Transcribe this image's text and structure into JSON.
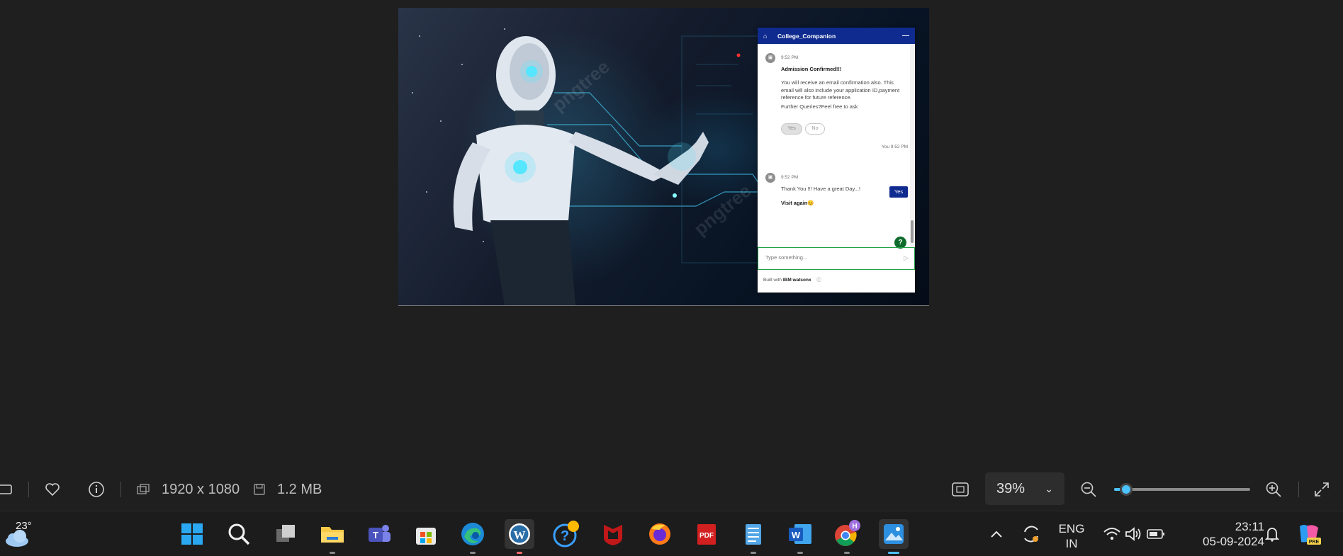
{
  "chat": {
    "title": "College_Companion",
    "messages": [
      {
        "time": "9:52 PM",
        "heading": "Admission Confirmed!!!",
        "body": "You will receive an email confirmation also. This email will also include your application ID,payment reference for future reference.",
        "followup": "Further Queries?Feel free to ask",
        "options": [
          "Yes",
          "No"
        ]
      },
      {
        "sender": "You 9:52 PM",
        "text": "Yes"
      },
      {
        "time": "9:52 PM",
        "text": "Thank You !!! Have a great Day...!",
        "closing": "Visit again😊"
      }
    ],
    "input_placeholder": "Type something...",
    "footer_prefix": "Built with",
    "footer_brand": "IBM watsonx",
    "help_label": "?"
  },
  "viewer": {
    "dimensions": "1920 x 1080",
    "file_size": "1.2 MB",
    "zoom_level": "39%",
    "zoom_slider_fraction": 0.09
  },
  "weather": {
    "temp": "23°"
  },
  "tray": {
    "lang_top": "ENG",
    "lang_bottom": "IN",
    "time": "23:11",
    "date": "05-09-2024"
  },
  "taskbar_apps": [
    "start",
    "search",
    "task-view",
    "file-explorer",
    "teams",
    "microsoft-store",
    "edge",
    "wordpress",
    "help",
    "mcafee",
    "firefox",
    "pdf",
    "notepad",
    "word",
    "chrome",
    "photos"
  ],
  "colors": {
    "chat_header": "#0f2b8f",
    "accent": "#4cc2ff",
    "help_green": "#0e6b2c",
    "input_border": "#24a148"
  }
}
